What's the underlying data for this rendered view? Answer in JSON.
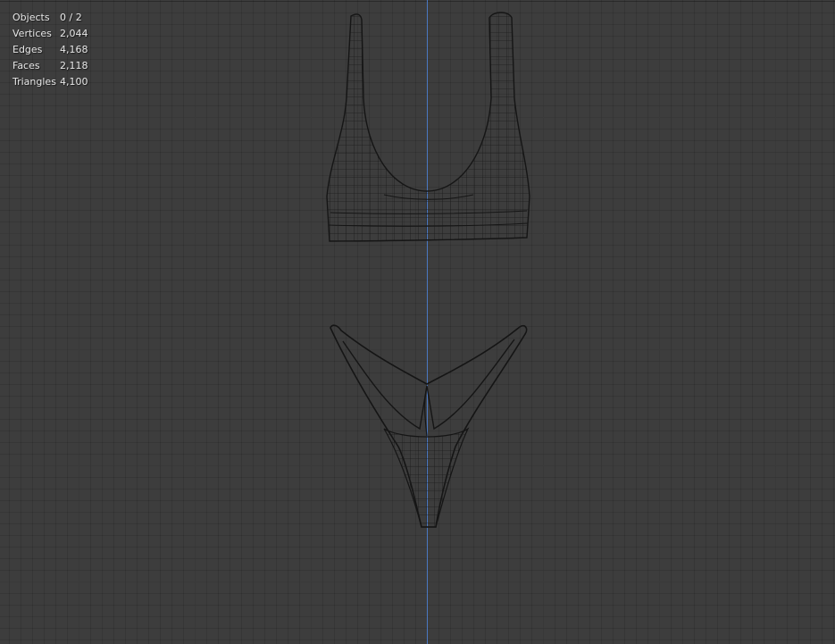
{
  "viewport": {
    "background": "#3d3d3d",
    "axis_color": "#4a78c2",
    "wire_color": "#1a1a1a"
  },
  "stats": [
    {
      "label": "Objects",
      "value": "0 / 2"
    },
    {
      "label": "Vertices",
      "value": "2,044"
    },
    {
      "label": "Edges",
      "value": "4,168"
    },
    {
      "label": "Faces",
      "value": "2,118"
    },
    {
      "label": "Triangles",
      "value": "4,100"
    }
  ],
  "objects": [
    {
      "name": "bikini-top"
    },
    {
      "name": "bikini-bottom"
    }
  ]
}
